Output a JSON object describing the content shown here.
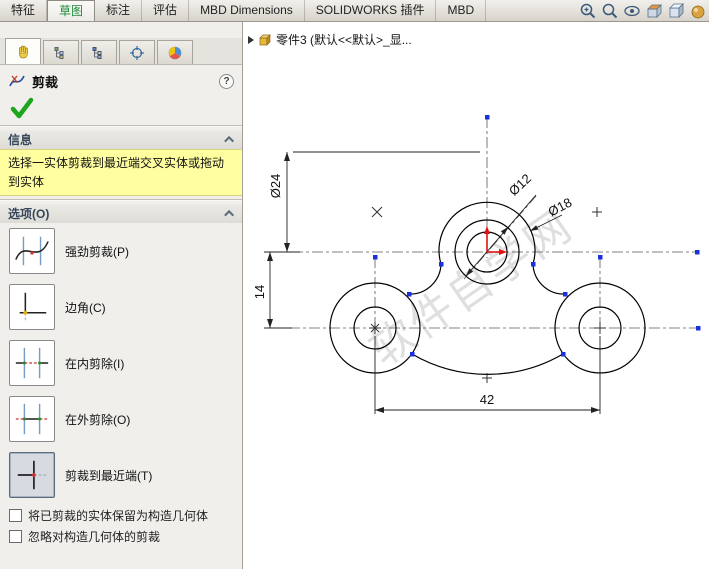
{
  "tabbar": {
    "tabs": [
      {
        "label": "特征"
      },
      {
        "label": "草图"
      },
      {
        "label": "标注"
      },
      {
        "label": "评估"
      },
      {
        "label": "MBD Dimensions"
      },
      {
        "label": "SOLIDWORKS 插件"
      },
      {
        "label": "MBD"
      }
    ],
    "right_icons": [
      "zoom-in-icon",
      "zoom-fit-icon",
      "view-settings-icon",
      "section-view-icon",
      "view-orientation-icon",
      "appearance-icon"
    ]
  },
  "property_manager": {
    "pm_tabs": [
      "propertymanager-tab",
      "featuremanager-tab",
      "configurationmanager-tab",
      "dimxpertmanager-tab",
      "displaymanager-tab"
    ],
    "title": "剪裁",
    "help_label": "?",
    "message": {
      "header": "信息",
      "text": "选择一实体剪裁到最近端交叉实体或拖动到实体"
    },
    "options": {
      "header": "选项(O)",
      "items": [
        {
          "label": "强劲剪裁(P)",
          "selected": false
        },
        {
          "label": "边角(C)",
          "selected": false
        },
        {
          "label": "在内剪除(I)",
          "selected": false
        },
        {
          "label": "在外剪除(O)",
          "selected": false
        },
        {
          "label": "剪裁到最近端(T)",
          "selected": true
        }
      ],
      "checkboxes": [
        {
          "label": "将已剪裁的实体保留为构造几何体",
          "checked": false
        },
        {
          "label": "忽略对构造几何体的剪裁",
          "checked": false
        }
      ]
    }
  },
  "canvas": {
    "tree_item": "零件3 (默认<<默认>_显...",
    "watermark": "软件自学网",
    "dimensions": {
      "d24": "Ø24",
      "d14": "14",
      "d42": "42",
      "d12": "Ø12",
      "d18": "Ø18"
    }
  },
  "colors": {
    "active_tab_text": "#1f8a3a",
    "message_bg": "#ffffa0",
    "check_green": "#1ea51e",
    "sketch_point_blue": "#1a2fe0",
    "origin_red": "#e01010"
  }
}
